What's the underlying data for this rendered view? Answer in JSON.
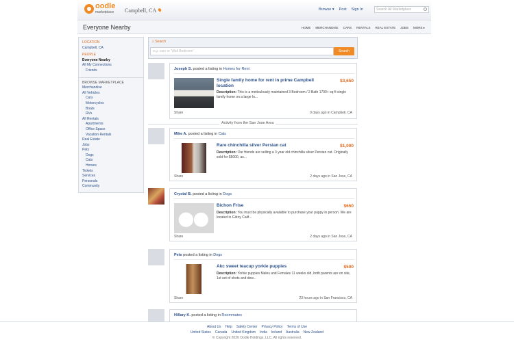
{
  "header": {
    "logo_text": "oodle",
    "logo_sub": "marketplace",
    "city": "Campbell, CA",
    "nav": [
      "Browse ▾",
      "Post",
      "Sign In"
    ],
    "search_placeholder": "Search All Marketplace"
  },
  "subbar": {
    "title": "Everyone Nearby",
    "categories": [
      "HOME",
      "MERCHANDISE",
      "CARS",
      "RENTALS",
      "REAL ESTATE",
      "JOBS",
      "MORE ▸"
    ]
  },
  "sidebar": {
    "location_label": "LOCATION",
    "location_value": "Campbell, CA",
    "people_label": "PEOPLE",
    "people_items": [
      "Everyone Nearby",
      "All My Connections",
      "Friends"
    ],
    "browse_label": "BROWSE MARKETPLACE",
    "browse_items": [
      {
        "label": "Merchandise",
        "indent": false
      },
      {
        "label": "All Vehicles",
        "indent": false
      },
      {
        "label": "Cars",
        "indent": true
      },
      {
        "label": "Motorcycles",
        "indent": true
      },
      {
        "label": "Boats",
        "indent": true
      },
      {
        "label": "RVs",
        "indent": true
      },
      {
        "label": "All Rentals",
        "indent": false
      },
      {
        "label": "Apartments",
        "indent": true
      },
      {
        "label": "Office Space",
        "indent": true
      },
      {
        "label": "Vacation Rentals",
        "indent": true
      },
      {
        "label": "Real Estate",
        "indent": false
      },
      {
        "label": "Jobs",
        "indent": false
      },
      {
        "label": "Pets",
        "indent": false
      },
      {
        "label": "Dogs",
        "indent": true
      },
      {
        "label": "Cats",
        "indent": true
      },
      {
        "label": "Horses",
        "indent": true
      },
      {
        "label": "Tickets",
        "indent": false
      },
      {
        "label": "Services",
        "indent": false
      },
      {
        "label": "Personals",
        "indent": false
      },
      {
        "label": "Community",
        "indent": false
      }
    ]
  },
  "search": {
    "label": "Search",
    "placeholder": "e.g. cars or 'Wall Bedroom'",
    "button": "Search"
  },
  "divider_text": "Activity from the San Jose Area",
  "listings": [
    {
      "poster": "Joseph S.",
      "verb": "posted a listing in",
      "category": "Homes for Rent",
      "title": "Single family home for rent in prime Campbell location",
      "price": "$3,650",
      "desc_label": "Description:",
      "desc": "This is a meticulously maintained 3 Bedroom / 2 Bath 1700+ sq ft single family home on a large lo...",
      "share": "Share",
      "when": "0 days ago in Campbell, CA"
    },
    {
      "poster": "Mike A.",
      "verb": "posted a listing in",
      "category": "Cats",
      "title": "Rare chinchilla silver Persian cat",
      "price": "$1,000",
      "desc_label": "Description:",
      "desc": "Our friends are selling a 3 year old chinchilla silver Persian cat. Originally sold for $5000, as...",
      "share": "Share",
      "when": "2 days ago in San Jose, CA"
    },
    {
      "poster": "Crystal B.",
      "verb": "posted a listing in",
      "category": "Dogs",
      "title": "Bichon Frise",
      "price": "$650",
      "desc_label": "Description:",
      "desc": "You must be physically available to purchase your puppy in person. We are located in Gilroy Calif...",
      "share": "Share",
      "when": "2 days ago in San Jose, CA"
    },
    {
      "poster": "Pets",
      "verb": "posted a listing in",
      "category": "Dogs",
      "title": "Akc sweet teacup yorkie puppies",
      "price": "$500",
      "desc_label": "Description:",
      "desc": "Yorkie puppies Males and Females 11 weeks old, both parents are on site, 1st set of shots and dew...",
      "share": "Share",
      "when": "23 hours ago in San Francisco, CA"
    },
    {
      "poster": "Hillary K.",
      "verb": "posted a listing in",
      "category": "Roommates"
    }
  ],
  "footer": {
    "links1": [
      "About Us",
      "Help",
      "Safety Center",
      "Privacy Policy",
      "Terms of Use"
    ],
    "links2": [
      "United States",
      "Canada",
      "United Kingdom",
      "India",
      "Ireland",
      "Australia",
      "New Zealand"
    ],
    "copyright": "© Copyright 2020 Oodle Holdings, LLC. All rights reserved."
  }
}
